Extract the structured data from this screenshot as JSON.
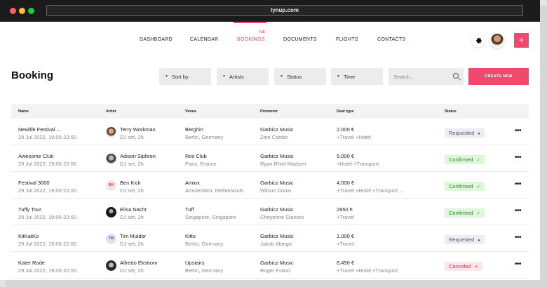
{
  "browser": {
    "url": "lynup.com",
    "dot_colors": [
      "#ff5f57",
      "#febc2e",
      "#28c840"
    ]
  },
  "nav": {
    "items": [
      "DASHBOARD",
      "CALENDAR",
      "BOOKINGS",
      "DOCUMENTS",
      "FLIGHTS",
      "CONTACTS"
    ],
    "active": "BOOKINGS",
    "bookings_badge": "+16",
    "accent": "#ef4a6e"
  },
  "header": {
    "add_label": "+"
  },
  "page": {
    "title": "Booking"
  },
  "filters": {
    "sort": "Sort by",
    "artists": "Artists",
    "status": "Status",
    "time": "Time"
  },
  "search": {
    "placeholder": "Search..."
  },
  "create_label": "CREATE NEW",
  "table": {
    "columns": {
      "name": "Name",
      "artist": "Artist",
      "venue": "Venue",
      "promotor": "Promotor",
      "deal": "Deal type",
      "status": "Status"
    },
    "rows": [
      {
        "name": "Newlife Festival  ...",
        "date": "29 Jul 2022, 19:00-22:00",
        "artist": "Terry Workman",
        "artist_sub": "DJ set, 2h",
        "avatar": "",
        "venue": "Berghin",
        "venue_sub": "Berlin, Germany",
        "promotor": "Garbicz Music",
        "promotor_sub": "Zein Carder",
        "deal": "2.000 €",
        "deal_sub": "+Travel +Hotel",
        "status": "Requested",
        "status_kind": "req"
      },
      {
        "name": "Awesome Club",
        "date": "29 Jul 2022, 19:00-22:00",
        "artist": "Adison Siphron",
        "artist_sub": "DJ set, 2h",
        "avatar": "",
        "venue": "Rox Club",
        "venue_sub": "Paris, France",
        "promotor": "Garbicz Music",
        "promotor_sub": "Ryan Rhiel Madsen",
        "deal": "5.000 €",
        "deal_sub": "+Hotel +Transport",
        "status": "Confirmed",
        "status_kind": "conf"
      },
      {
        "name": "Festival 3000",
        "date": "29 Jul 2022, 19:00-22:00",
        "artist": "Ben Kick",
        "artist_sub": "DJ set, 2h",
        "avatar": "BK",
        "venue": "Amiox",
        "venue_sub": "Amsterdam, Netherlands",
        "promotor": "Garbicz Music",
        "promotor_sub": "Wilson Donin",
        "deal": "4.000 €",
        "deal_sub": "+Travel +Hotel +Transport ...",
        "status": "Confirmed",
        "status_kind": "conf"
      },
      {
        "name": "Tuffy Tour",
        "date": "29 Jul 2022, 19:00-22:00",
        "artist": "Elisa Nacht",
        "artist_sub": "DJ set, 2h",
        "avatar": "",
        "venue": "Tuff",
        "venue_sub": "Singapore, Singapore",
        "promotor": "Garbicz Music",
        "promotor_sub": "Cheyenne Stanton",
        "deal": "2950 €",
        "deal_sub": "+Travel",
        "status": "Confirmed",
        "status_kind": "conf"
      },
      {
        "name": "KitKatKo",
        "date": "29 Jul 2022, 19:00-22:00",
        "artist": "Tim Muldor",
        "artist_sub": "DJ set, 2h",
        "avatar": "TM",
        "venue": "Kitto",
        "venue_sub": "Berlin, Germany",
        "promotor": "Garbicz Music",
        "promotor_sub": "Jakob Mango",
        "deal": "1.000 €",
        "deal_sub": "+Travel",
        "status": "Requested",
        "status_kind": "req"
      },
      {
        "name": "Kater Rode",
        "date": "29 Jul 2022, 19:00-22:00",
        "artist": "Alfredo Ekstrom",
        "artist_sub": "DJ set, 2h",
        "avatar": "",
        "venue": "Upstairs",
        "venue_sub": "Berlin, Germany",
        "promotor": "Garbicz Music",
        "promotor_sub": "Roger Franci",
        "deal": "8.450 €",
        "deal_sub": "+Travel +Hotel +Transport",
        "status": "Canceled",
        "status_kind": "can"
      }
    ]
  }
}
